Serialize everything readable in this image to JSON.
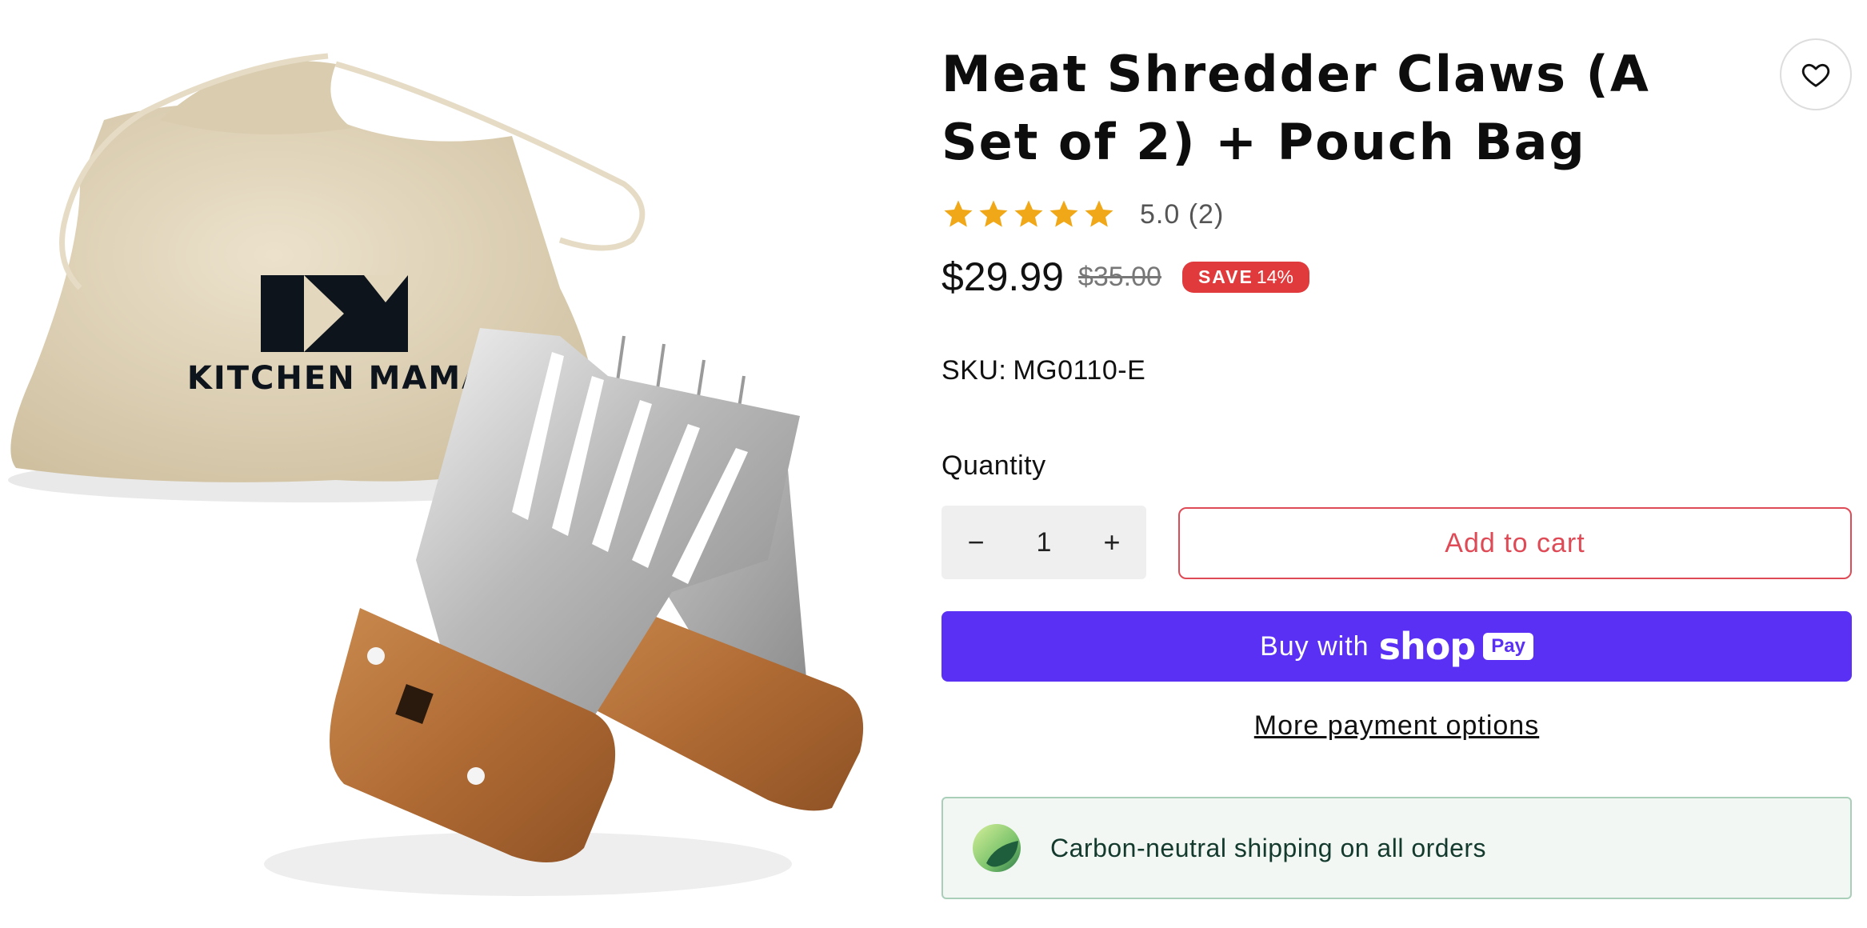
{
  "product": {
    "title": "Meat Shredder Claws (A Set of 2) + Pouch Bag",
    "image_brand_text": "KITCHEN MAMA",
    "rating": 5,
    "rating_text": "5.0 (2)",
    "price": "$29.99",
    "compare_price": "$35.00",
    "save_label": "SAVE",
    "save_percent": "14%",
    "sku_label": "SKU:",
    "sku": "MG0110-E"
  },
  "purchase": {
    "quantity_label": "Quantity",
    "quantity_value": "1",
    "decrement_label": "−",
    "increment_label": "+",
    "add_to_cart_label": "Add to cart",
    "shop_pay_prefix": "Buy with",
    "shop_pay_brand": "shop",
    "shop_pay_chip": "Pay",
    "more_payment_label": "More payment options"
  },
  "shipping": {
    "text": "Carbon-neutral shipping on all orders"
  },
  "colors": {
    "star": "#f0a818",
    "save_badge": "#e03a3c",
    "add_to_cart": "#de4a55",
    "shop_pay": "#5a31f4",
    "banner_bg": "#f2f7f4"
  },
  "icons": {
    "wishlist": "heart-icon",
    "star": "star-icon",
    "shipping": "leaf-icon"
  }
}
